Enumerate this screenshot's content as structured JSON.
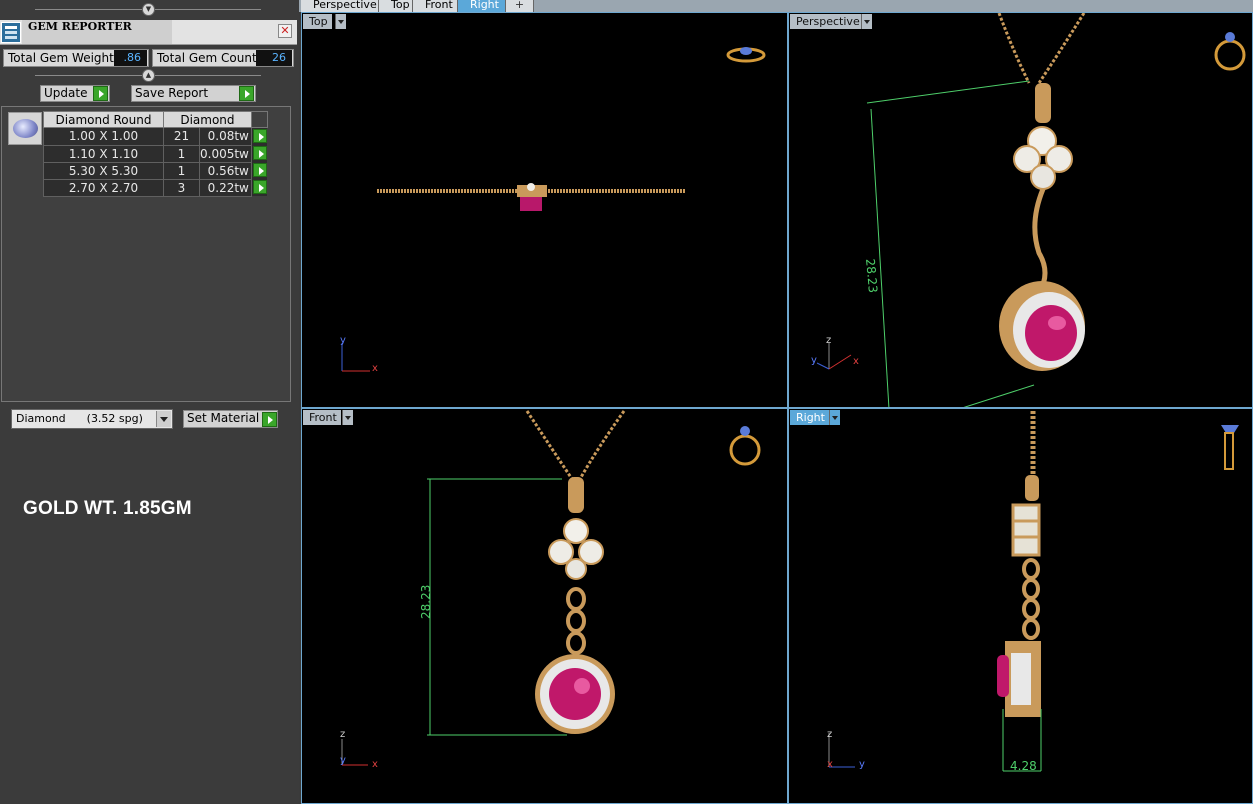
{
  "gem_reporter": {
    "title": "GEM REPORTER",
    "total_weight_label": "Total Gem Weight",
    "total_weight_value": ".86",
    "total_count_label": "Total Gem Count",
    "total_count_value": "26",
    "update_label": "Update",
    "save_report_label": "Save Report",
    "table": {
      "col_shape": "Diamond Round",
      "col_material": "Diamond",
      "rows": [
        {
          "size": "1.00 X 1.00",
          "count": "21",
          "weight": "0.08tw"
        },
        {
          "size": "1.10 X 1.10",
          "count": "1",
          "weight": "0.005tw"
        },
        {
          "size": "5.30 X 5.30",
          "count": "1",
          "weight": "0.56tw"
        },
        {
          "size": "2.70 X 2.70",
          "count": "3",
          "weight": "0.22tw"
        }
      ]
    },
    "material_select": "Diamond      (3.52 spg)",
    "set_material_label": "Set Material",
    "gold_weight_text": "GOLD WT. 1.85GM"
  },
  "tabs": [
    "Perspective",
    "Top",
    "Front",
    "Right"
  ],
  "active_tab": "Right",
  "add_tab_label": "+",
  "viewports": {
    "top": {
      "label": "Top",
      "axes": [
        "y",
        "x"
      ]
    },
    "perspective": {
      "label": "Perspective",
      "axes": [
        "z",
        "y",
        "x"
      ],
      "dimension": "28.23"
    },
    "front": {
      "label": "Front",
      "axes": [
        "z",
        "y",
        "x"
      ],
      "dimension": "28.23"
    },
    "right": {
      "label": "Right",
      "axes": [
        "z",
        "x",
        "y"
      ],
      "dimension": "4.28"
    }
  },
  "colors": {
    "accent": "#5ba8d9",
    "gold": "#c99a5b",
    "ruby": "#c0186a",
    "dimension": "#4ecf6a",
    "go_button": "#3aa62a"
  }
}
